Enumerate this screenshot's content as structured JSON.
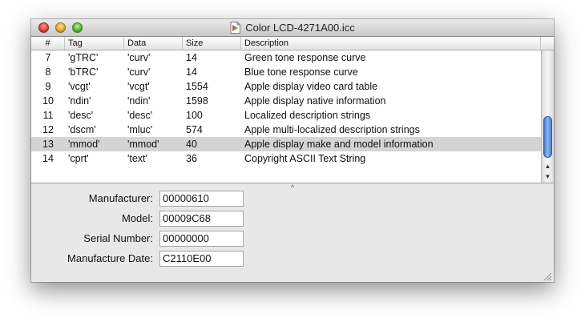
{
  "window": {
    "title": "Color LCD-4271A00.icc",
    "title_icon": "colorsync-profile-icon"
  },
  "table": {
    "columns": [
      "#",
      "Tag",
      "Data",
      "Size",
      "Description"
    ],
    "rows": [
      {
        "num": "7",
        "tag": "'gTRC'",
        "data": "'curv'",
        "size": "14",
        "desc": "Green tone response curve",
        "selected": false
      },
      {
        "num": "8",
        "tag": "'bTRC'",
        "data": "'curv'",
        "size": "14",
        "desc": "Blue tone response curve",
        "selected": false
      },
      {
        "num": "9",
        "tag": "'vcgt'",
        "data": "'vcgt'",
        "size": "1554",
        "desc": "Apple display video card table",
        "selected": false
      },
      {
        "num": "10",
        "tag": "'ndin'",
        "data": "'ndin'",
        "size": "1598",
        "desc": "Apple display native information",
        "selected": false
      },
      {
        "num": "11",
        "tag": "'desc'",
        "data": "'desc'",
        "size": "100",
        "desc": "Localized description strings",
        "selected": false
      },
      {
        "num": "12",
        "tag": "'dscm'",
        "data": "'mluc'",
        "size": "574",
        "desc": "Apple multi-localized description strings",
        "selected": false
      },
      {
        "num": "13",
        "tag": "'mmod'",
        "data": "'mmod'",
        "size": "40",
        "desc": "Apple display make and model information",
        "selected": true
      },
      {
        "num": "14",
        "tag": "'cprt'",
        "data": "'text'",
        "size": "36",
        "desc": "Copyright ASCII Text String",
        "selected": false
      }
    ]
  },
  "details": {
    "fields": [
      {
        "label": "Manufacturer:",
        "value": "00000610"
      },
      {
        "label": "Model:",
        "value": "00009C68"
      },
      {
        "label": "Serial Number:",
        "value": "00000000"
      },
      {
        "label": "Manufacture Date:",
        "value": "C2110E00"
      }
    ]
  },
  "colors": {
    "selection": "#d4d4d4",
    "scroll_thumb": "#5a8ede",
    "close": "#e0443a",
    "minimize": "#e3a72a",
    "zoom": "#55b63b"
  }
}
